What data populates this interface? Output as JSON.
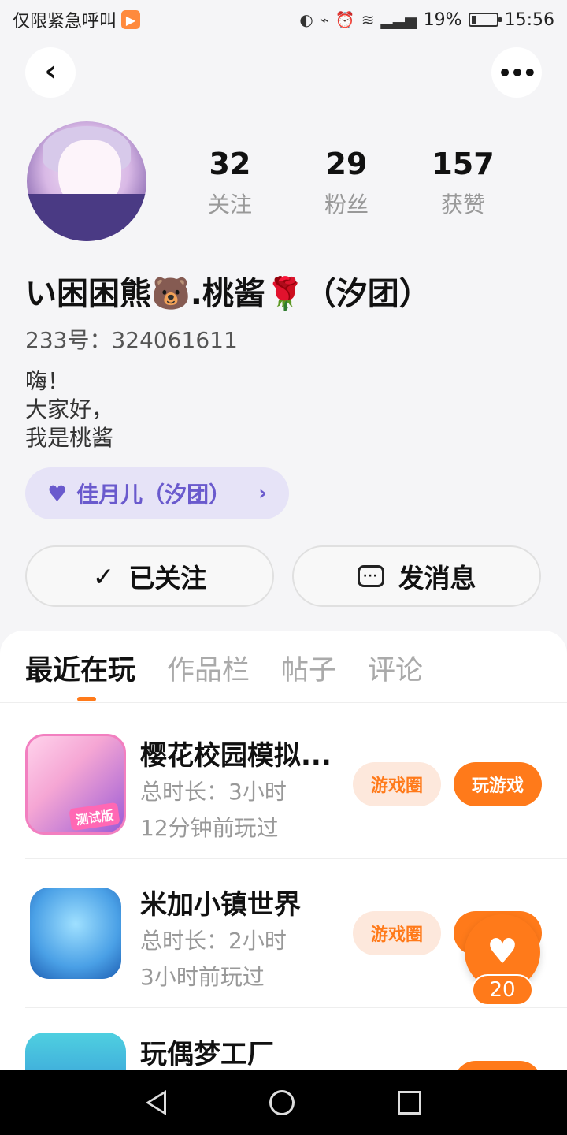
{
  "status_bar": {
    "left_text": "仅限紧急呼叫",
    "app_icon": "play-arrow-icon",
    "battery_text": "19%",
    "time": "15:56"
  },
  "header": {
    "back_icon": "chevron-left-icon",
    "more_icon": "more-icon"
  },
  "profile": {
    "stats": [
      {
        "value": "32",
        "label": "关注"
      },
      {
        "value": "29",
        "label": "粉丝"
      },
      {
        "value": "157",
        "label": "获赞"
      }
    ],
    "username": "い困困熊🐻.桃酱🌹（汐团）",
    "user_id": "233号：324061611",
    "bio_lines": [
      "嗨！",
      "大家好，",
      "我是桃酱"
    ],
    "team_chip": "佳月儿（汐团）"
  },
  "actions": {
    "follow_label": "已关注",
    "message_label": "发消息"
  },
  "tabs": [
    "最近在玩",
    "作品栏",
    "帖子",
    "评论"
  ],
  "games": [
    {
      "name": "樱花校园模拟...",
      "duration": "总时长：3小时",
      "last_played": "12分钟前玩过",
      "circle_label": "游戏圈",
      "play_label": "玩游戏",
      "badge": "测试版"
    },
    {
      "name": "米加小镇世界",
      "duration": "总时长：2小时",
      "last_played": "3小时前玩过",
      "circle_label": "游戏圈"
    },
    {
      "name": "玩偶梦工厂"
    }
  ],
  "floating_like": {
    "count": "20"
  },
  "colors": {
    "accent": "#ff7a1a",
    "team_chip_bg": "#e6e3f7",
    "team_chip_text": "#6a5acd"
  }
}
